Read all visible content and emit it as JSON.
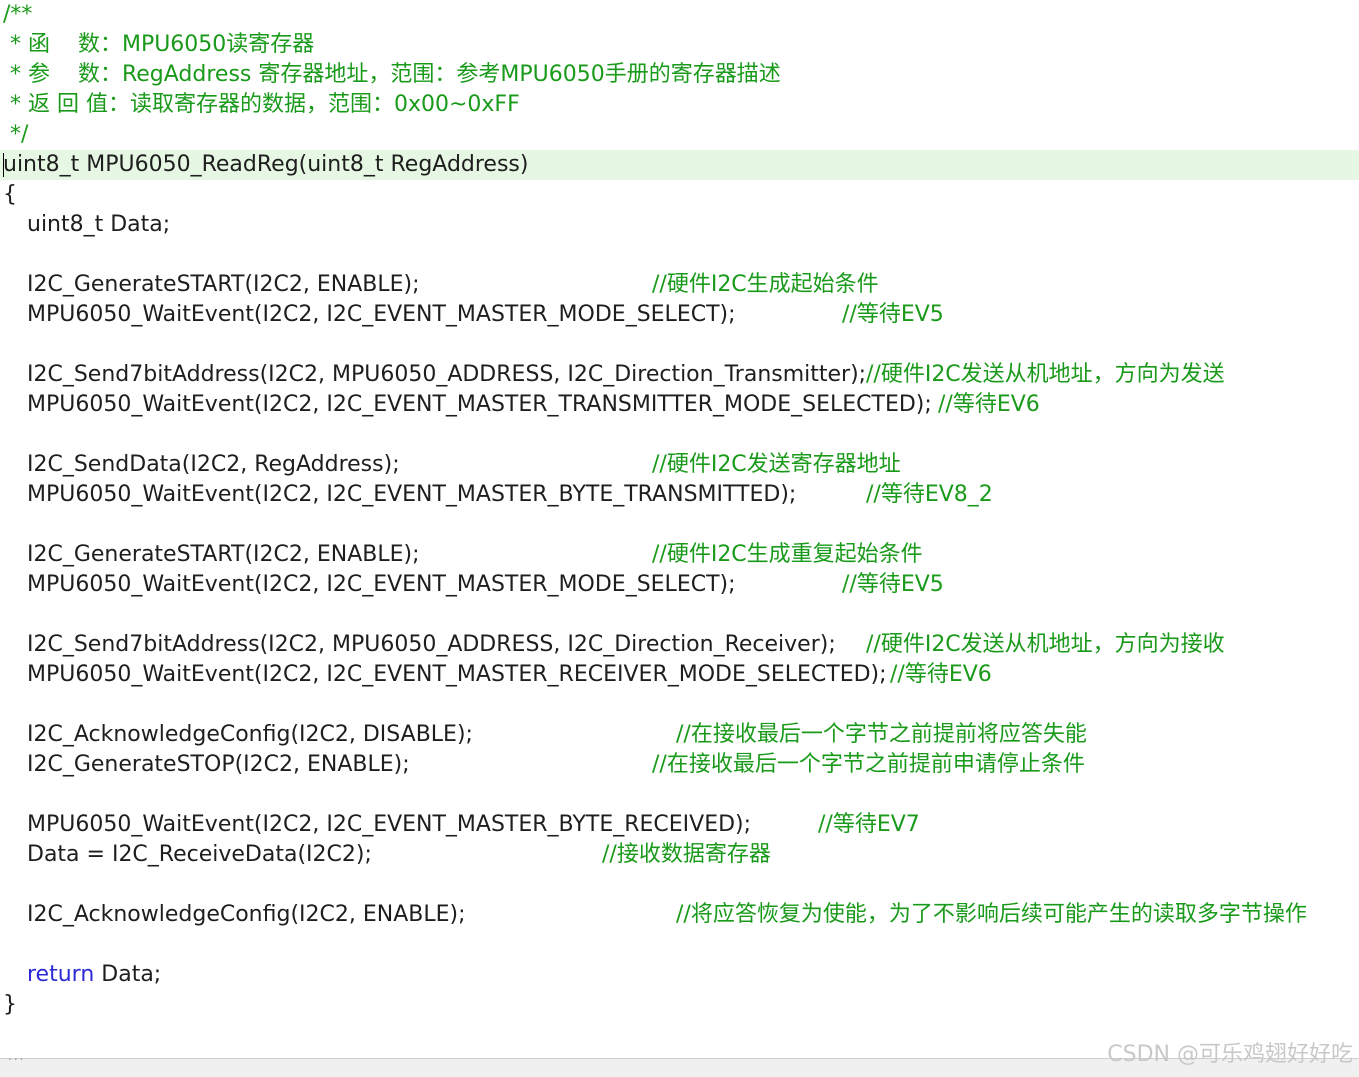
{
  "editor": {
    "lines": [
      {
        "comment": "/**"
      },
      {
        "comment": " * 函    数：MPU6050读寄存器"
      },
      {
        "comment": " * 参    数：RegAddress 寄存器地址，范围：参考MPU6050手册的寄存器描述"
      },
      {
        "comment": " * 返 回 值：读取寄存器的数据，范围：0x00~0xFF"
      },
      {
        "comment": " */"
      },
      {
        "code": "uint8_t MPU6050_ReadReg(uint8_t RegAddress)",
        "current": true
      },
      {
        "code": "{"
      },
      {
        "code": "uint8_t Data;",
        "indent": true
      },
      {},
      {
        "code": "I2C_GenerateSTART(I2C2, ENABLE);",
        "indent": true,
        "comment": "//硬件I2C生成起始条件"
      },
      {
        "code": "MPU6050_WaitEvent(I2C2, I2C_EVENT_MASTER_MODE_SELECT);",
        "indent": true,
        "comment": "//等待EV5"
      },
      {},
      {
        "code": "I2C_Send7bitAddress(I2C2, MPU6050_ADDRESS, I2C_Direction_Transmitter);",
        "indent": true,
        "comment": "//硬件I2C发送从机地址，方向为发送"
      },
      {
        "code": "MPU6050_WaitEvent(I2C2, I2C_EVENT_MASTER_TRANSMITTER_MODE_SELECTED);",
        "indent": true,
        "comment": "//等待EV6"
      },
      {},
      {
        "code": "I2C_SendData(I2C2, RegAddress);",
        "indent": true,
        "comment": "//硬件I2C发送寄存器地址"
      },
      {
        "code": "MPU6050_WaitEvent(I2C2, I2C_EVENT_MASTER_BYTE_TRANSMITTED);",
        "indent": true,
        "comment": "//等待EV8_2"
      },
      {},
      {
        "code": "I2C_GenerateSTART(I2C2, ENABLE);",
        "indent": true,
        "comment": "//硬件I2C生成重复起始条件"
      },
      {
        "code": "MPU6050_WaitEvent(I2C2, I2C_EVENT_MASTER_MODE_SELECT);",
        "indent": true,
        "comment": "//等待EV5"
      },
      {},
      {
        "code": "I2C_Send7bitAddress(I2C2, MPU6050_ADDRESS, I2C_Direction_Receiver);",
        "indent": true,
        "comment": "//硬件I2C发送从机地址，方向为接收"
      },
      {
        "code": "MPU6050_WaitEvent(I2C2, I2C_EVENT_MASTER_RECEIVER_MODE_SELECTED);",
        "indent": true,
        "comment": "//等待EV6"
      },
      {},
      {
        "code": "I2C_AcknowledgeConfig(I2C2, DISABLE);",
        "indent": true,
        "comment": "//在接收最后一个字节之前提前将应答失能"
      },
      {
        "code": "I2C_GenerateSTOP(I2C2, ENABLE);",
        "indent": true,
        "comment": "//在接收最后一个字节之前提前申请停止条件"
      },
      {},
      {
        "code": "MPU6050_WaitEvent(I2C2, I2C_EVENT_MASTER_BYTE_RECEIVED);",
        "indent": true,
        "comment": "//等待EV7"
      },
      {
        "code": "Data = I2C_ReceiveData(I2C2);",
        "indent": true,
        "comment": "//接收数据寄存器"
      },
      {},
      {
        "code": "I2C_AcknowledgeConfig(I2C2, ENABLE);",
        "indent": true,
        "comment": "//将应答恢复为使能，为了不影响后续可能产生的读取多字节操作"
      },
      {},
      {
        "keyword": "return",
        "code": " Data;",
        "indent": true
      },
      {
        "code": "}"
      }
    ]
  },
  "status": {
    "dots": "...",
    "watermark": "CSDN @可乐鸡翅好好吃"
  },
  "colors": {
    "comment": "#1a9a1a",
    "keyword": "#2b2bd6",
    "current_line": "#e6f7e4"
  }
}
